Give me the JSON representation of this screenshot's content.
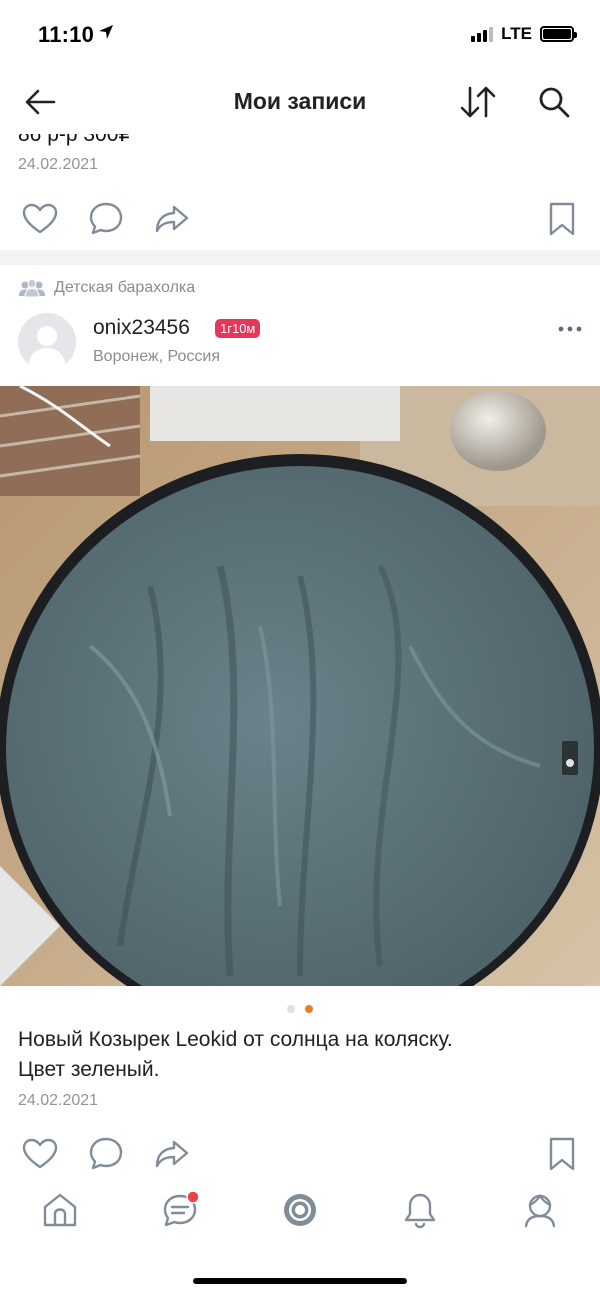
{
  "status": {
    "time": "11:10",
    "network": "LTE"
  },
  "nav": {
    "title": "Мои записи"
  },
  "prev_post": {
    "price_text": "86 р-р 300₽",
    "date": "24.02.2021"
  },
  "post": {
    "group": "Детская барахолка",
    "author": "onix23456",
    "badge": "1г10м",
    "location": "Воронеж, Россия",
    "text_line1": "Новый Козырек Leokid от солнца на коляску.",
    "text_line2": "Цвет зеленый.",
    "date": "24.02.2021",
    "photo_count": 2,
    "active_photo": 2
  },
  "colors": {
    "accent_orange": "#e67e22",
    "badge_red": "#e6375b",
    "icon_blue": "#5181b8",
    "icon_gray": "#818c99"
  },
  "tabs": [
    {
      "icon": "home-icon"
    },
    {
      "icon": "messages-icon",
      "has_badge": true
    },
    {
      "icon": "discover-icon"
    },
    {
      "icon": "notifications-icon"
    },
    {
      "icon": "profile-icon"
    }
  ]
}
